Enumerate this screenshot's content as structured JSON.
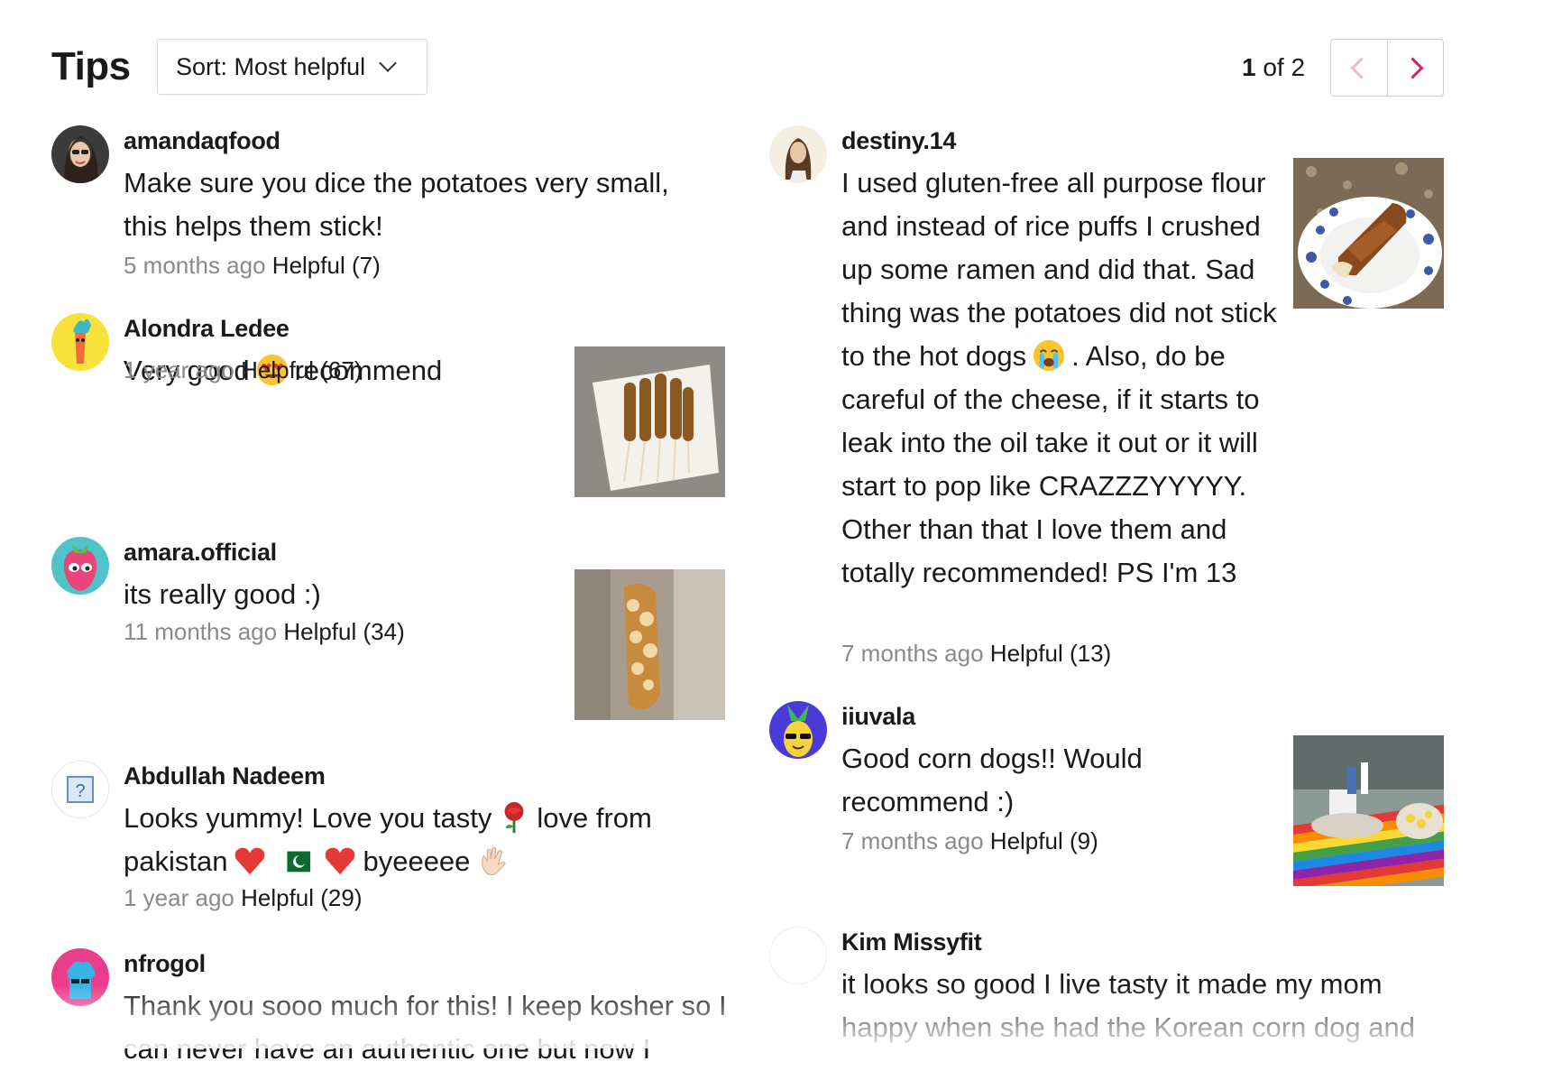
{
  "header": {
    "title": "Tips",
    "sort_label": "Sort: Most helpful",
    "page_current": "1",
    "page_of": "of 2"
  },
  "tips": [
    {
      "user": "amandaqfood",
      "text": "Make sure you dice the potatoes very small, this helps them stick!",
      "time": "5 months ago",
      "helpful": "Helpful (7)"
    },
    {
      "user": "Alondra Ledee",
      "text_a": "Very good",
      "text_b": "recommend",
      "time": "1 year ago",
      "helpful": "Helpful (67)",
      "photo": "corn-dogs-on-plate"
    },
    {
      "user": "amara.official",
      "text": "its really good :)",
      "time": "11 months ago",
      "helpful": "Helpful (34)",
      "photo": "corn-dog-closeup"
    },
    {
      "user": "Abdullah Nadeem",
      "text_a": "Looks yummy! Love you tasty",
      "text_b": "love from",
      "text_c": "pakistan",
      "text_d": "byeeeee",
      "time": "1 year ago",
      "helpful": "Helpful (29)"
    },
    {
      "user": "nfrogol",
      "text": "Thank you sooo much for this! I keep kosher so I can never have an authentic one but now I"
    },
    {
      "user": "destiny.14",
      "text_a": "I used gluten-free all purpose flour and instead of rice puffs I crushed up some ramen and did that. Sad thing was the potatoes did not stick to the hot dogs",
      "text_b": ". Also, do be careful of the cheese, if it starts to leak into the oil take it out or it will start to pop like CRAZZZYYYYY. Other than that I love them and totally recommended! PS I'm 13",
      "time": "7 months ago",
      "helpful": "Helpful (13)",
      "photo": "corn-dogs-on-paper-plate"
    },
    {
      "user": "iiuvala",
      "text": "Good corn dogs!! Would recommend :)",
      "time": "7 months ago",
      "helpful": "Helpful (9)",
      "photo": "picnic-table"
    },
    {
      "user": "Kim Missyfit",
      "text": "it looks so good I live tasty it made my mom happy when she had the Korean corn dog and"
    }
  ],
  "icons": {
    "heart_eyes": "heart-eyes-emoji",
    "crying": "crying-face-emoji",
    "rose": "rose-emoji",
    "red_heart": "red-heart-emoji",
    "pakistan_flag": "pakistan-flag-emoji",
    "waving_hand": "waving-hand-emoji"
  },
  "colors": {
    "accent": "#d6225c",
    "muted_text": "#8a8a8a",
    "border": "#d8d8d8"
  }
}
